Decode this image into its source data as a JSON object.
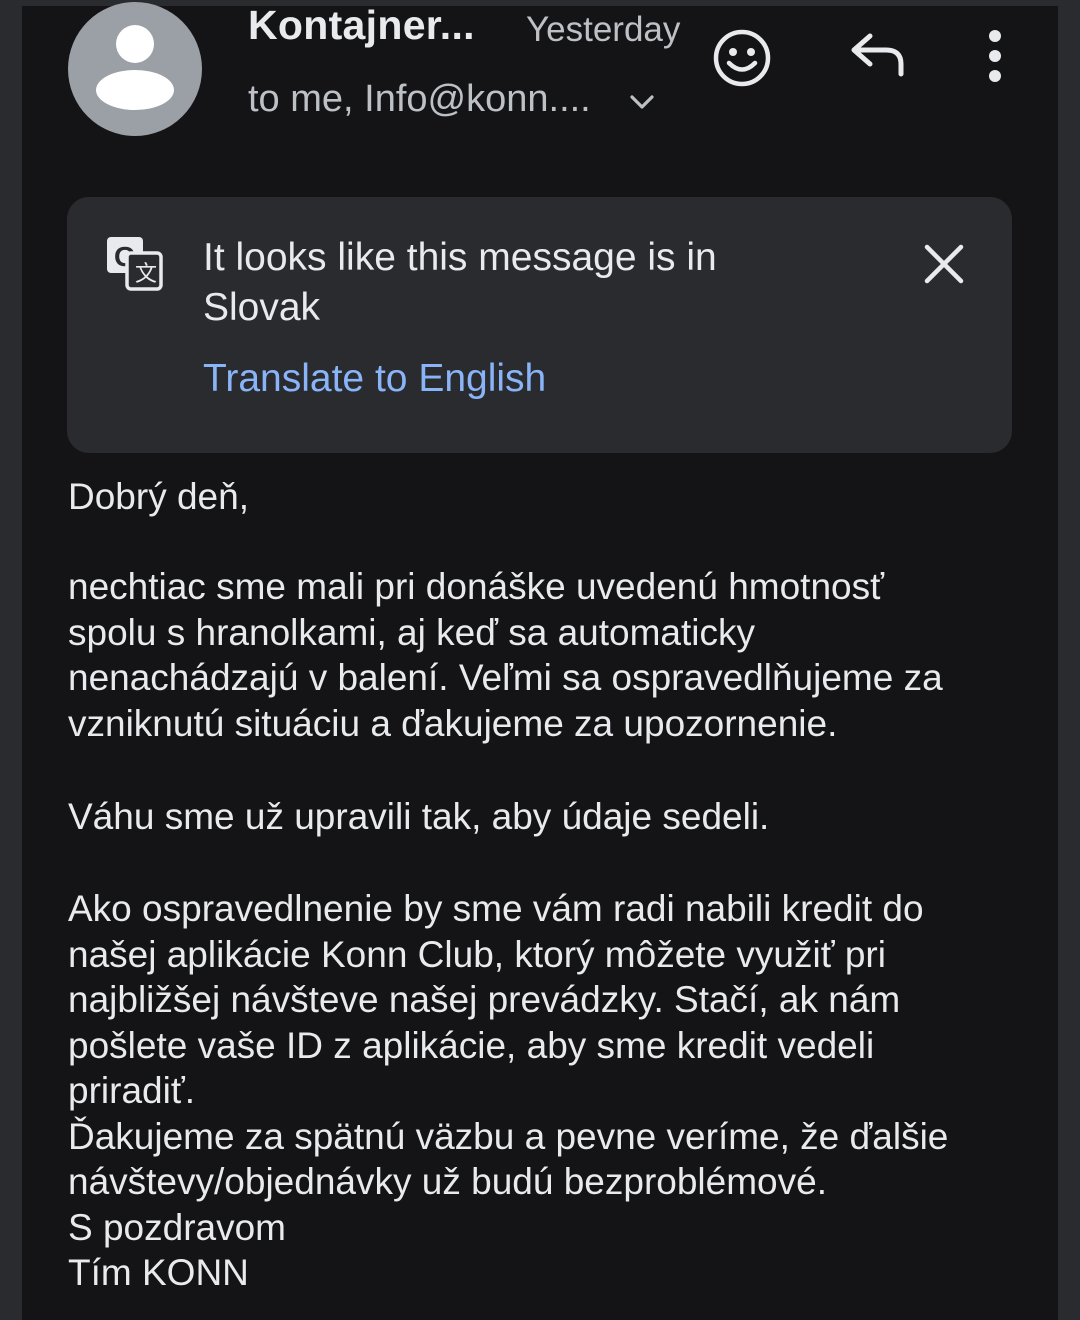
{
  "header": {
    "sender": "Kontajner...",
    "time": "Yesterday",
    "recipients": "to me, Info@konn....",
    "avatar_icon": "person-avatar-icon",
    "actions": [
      "smiley-icon",
      "reply-icon",
      "more-vert-icon"
    ]
  },
  "translate": {
    "message_line1": "It looks like this message is in",
    "message_line2": "Slovak",
    "action_label": "Translate to English",
    "icon": "google-translate-icon",
    "close_icon": "close-icon",
    "link_color": "#8ab4f8"
  },
  "body": {
    "greeting": "Dobrý deň,",
    "p1": [
      "nechtiac sme mali pri donáške uvedenú hmotnosť",
      "spolu s hranolkami, aj keď sa automaticky",
      "nenachádzajú v balení. Veľmi sa ospravedlňujeme za",
      "vzniknutú situáciu a ďakujeme za upozornenie."
    ],
    "p2": "Váhu sme už upravili tak, aby údaje sedeli.",
    "p3": [
      "Ako ospravedlnenie by sme vám radi nabili kredit do",
      "našej aplikácie Konn Club, ktorý môžete využiť pri",
      "najbližšej návšteve našej prevádzky. Stačí, ak nám",
      "pošlete vaše ID z aplikácie, aby sme kredit vedeli",
      "priradiť.",
      "Ďakujeme za spätnú väzbu a pevne veríme, že ďalšie",
      "návštevy/objednávky už budú bezproblémové.",
      "S pozdravom",
      "Tím KONN"
    ]
  }
}
